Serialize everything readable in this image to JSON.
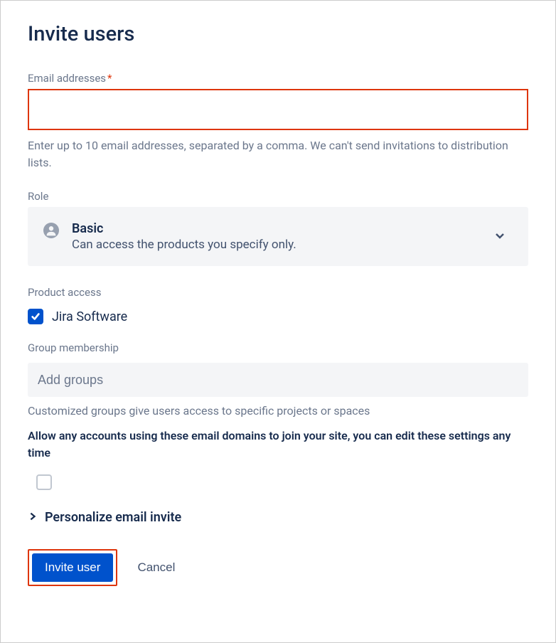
{
  "page_title": "Invite users",
  "email": {
    "label": "Email addresses",
    "required": "*",
    "value": "",
    "help": "Enter up to 10 email addresses, separated by a comma. We can't send invitations to distribution lists."
  },
  "role": {
    "label": "Role",
    "title": "Basic",
    "description": "Can access the products you specify only."
  },
  "product_access": {
    "label": "Product access",
    "item": "Jira Software",
    "checked": true
  },
  "groups": {
    "label": "Group membership",
    "placeholder": "Add groups",
    "help": "Customized groups give users access to specific projects or spaces"
  },
  "domain_allow": {
    "text": "Allow any accounts using these email domains to join your site, you can edit these settings any time",
    "checked": false
  },
  "personalize": {
    "label": "Personalize email invite"
  },
  "buttons": {
    "invite": "Invite   user",
    "cancel": "Cancel"
  }
}
